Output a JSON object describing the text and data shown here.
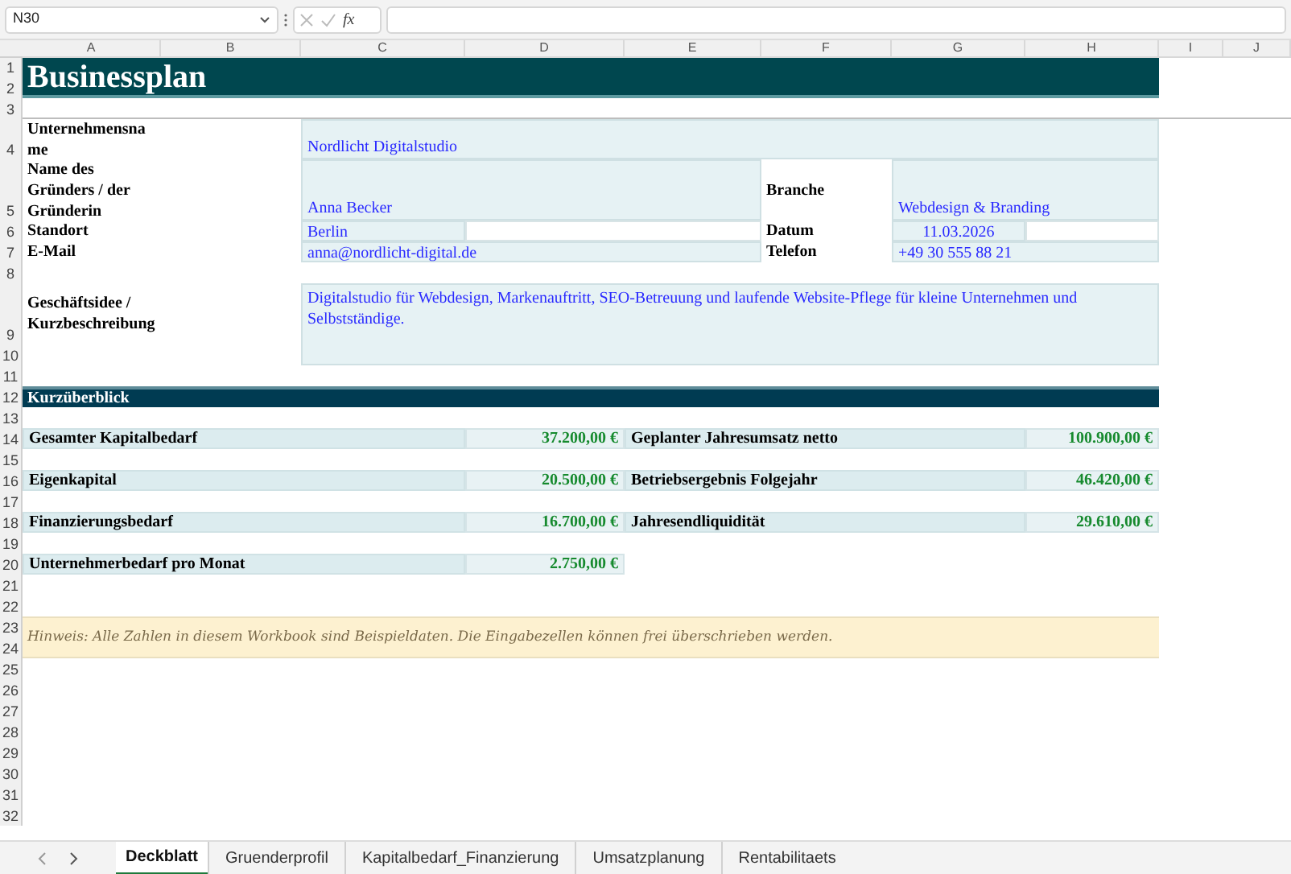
{
  "name_box": "N30",
  "formula_bar": {
    "function_label": "fx"
  },
  "columns": [
    "A",
    "B",
    "C",
    "D",
    "E",
    "F",
    "G",
    "H",
    "I",
    "J"
  ],
  "rows": [
    "1",
    "2",
    "3",
    "4",
    "5",
    "6",
    "7",
    "8",
    "9",
    "10",
    "11",
    "12",
    "13",
    "14",
    "15",
    "16",
    "17",
    "18",
    "19",
    "20",
    "21",
    "22",
    "23",
    "24",
    "25",
    "26",
    "27",
    "28",
    "29",
    "30",
    "31",
    "32"
  ],
  "title": "Businessplan",
  "profile": {
    "company": {
      "label": "Unternehmensname",
      "value": "Nordlicht Digitalstudio"
    },
    "founder": {
      "label": "Name des Gründers / der Gründerin",
      "value": "Anna Becker"
    },
    "industry": {
      "label": "Branche",
      "value": "Webdesign & Branding"
    },
    "location": {
      "label": "Standort",
      "value": "Berlin"
    },
    "date": {
      "label": "Datum",
      "value": "11.03.2026"
    },
    "email": {
      "label": "E-Mail",
      "value": "anna@nordlicht-digital.de"
    },
    "phone": {
      "label": "Telefon",
      "value": "+49 30 555 88 21"
    },
    "idea": {
      "label": "Geschäftsidee / Kurzbeschreibung",
      "value": "Digitalstudio für Webdesign, Markenauftritt, SEO-Betreuung und laufende Website-Pflege für kleine Unternehmen und Selbstständige."
    }
  },
  "overview": {
    "title": "Kurzüberblick",
    "items": [
      {
        "label": "Gesamter Kapitalbedarf",
        "value": "37.200,00 €"
      },
      {
        "label": "Geplanter Jahresumsatz netto",
        "value": "100.900,00 €"
      },
      {
        "label": "Eigenkapital",
        "value": "20.500,00 €"
      },
      {
        "label": "Betriebsergebnis Folgejahr",
        "value": "46.420,00 €"
      },
      {
        "label": "Finanzierungsbedarf",
        "value": "16.700,00 €"
      },
      {
        "label": "Jahresendliquidität",
        "value": "29.610,00 €"
      },
      {
        "label": "Unternehmerbedarf pro Monat",
        "value": "2.750,00 €"
      }
    ]
  },
  "note": "Hinweis: Alle Zahlen in diesem Workbook sind Beispieldaten. Die Eingabezellen können frei überschrieben werden.",
  "sheet_tabs": [
    {
      "label": "Deckblatt",
      "selected": true
    },
    {
      "label": "Gruenderprofil",
      "selected": false
    },
    {
      "label": "Kapitalbedarf_Finanzierung",
      "selected": false
    },
    {
      "label": "Umsatzplanung",
      "selected": false
    },
    {
      "label": "Rentabilitaets",
      "selected": false
    }
  ]
}
